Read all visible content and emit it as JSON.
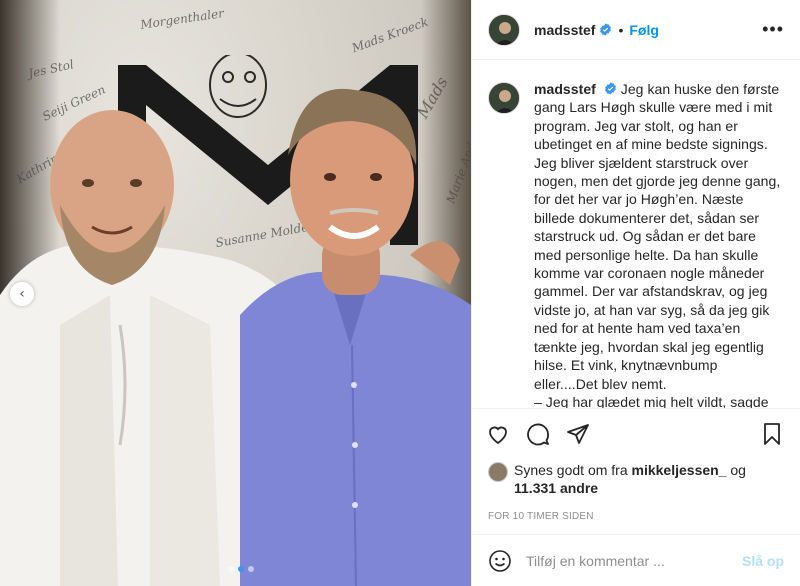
{
  "media": {
    "wall_scribbles": [
      "Morgenthaler",
      "Mads Kroeck",
      "Jes Stol",
      "Seiji Green",
      "Susanne Molde",
      "Marie Andersen",
      "Mads",
      "Kathrine"
    ],
    "nav_left_icon": "chevron-left-icon",
    "carousel": {
      "count": 3,
      "active_index": 1
    }
  },
  "header": {
    "username": "madsstef",
    "separator": "•",
    "follow_label": "Følg",
    "more_label": "•••"
  },
  "caption": {
    "username": "madsstef",
    "text": "Jeg kan huske den første gang Lars Høgh skulle være med i mit program. Jeg var stolt, og han er ubetinget en af mine bedste signings. Jeg bliver sjældent starstruck over nogen, men det gjorde jeg denne gang, for det her var jo Høgh’en. Næste billede dokumenterer det, sådan ser starstruck ud. Og sådan er det bare med personlige helte. Da han skulle komme var coronaen nogle måneder gammel. Der var afstandskrav, og jeg vidste jo, at han var syg, så da jeg gik ned for at hente ham ved taxa’en tænkte jeg, hvordan skal jeg egentlig hilse. Et vink, knytnævnbump eller....Det blev nemt.\n– Jeg har glædet mig helt vildt, sagde han og gav mig et stort kram. Det var"
  },
  "actions": {
    "like_icon": "heart-icon",
    "comment_icon": "comment-icon",
    "share_icon": "share-icon",
    "save_icon": "bookmark-icon"
  },
  "likes": {
    "prefix": "Synes godt om fra ",
    "user": "mikkeljessen_",
    "joiner": " og",
    "count": "11.331 andre"
  },
  "timestamp": "FOR 10 TIMER SIDEN",
  "comment_box": {
    "placeholder": "Tilføj en kommentar ...",
    "post_label": "Slå op"
  },
  "colors": {
    "link_blue": "#0095f6",
    "post_disabled": "#b2dffc",
    "meta_gray": "#8e8e8e",
    "verified_blue": "#3897f0"
  }
}
